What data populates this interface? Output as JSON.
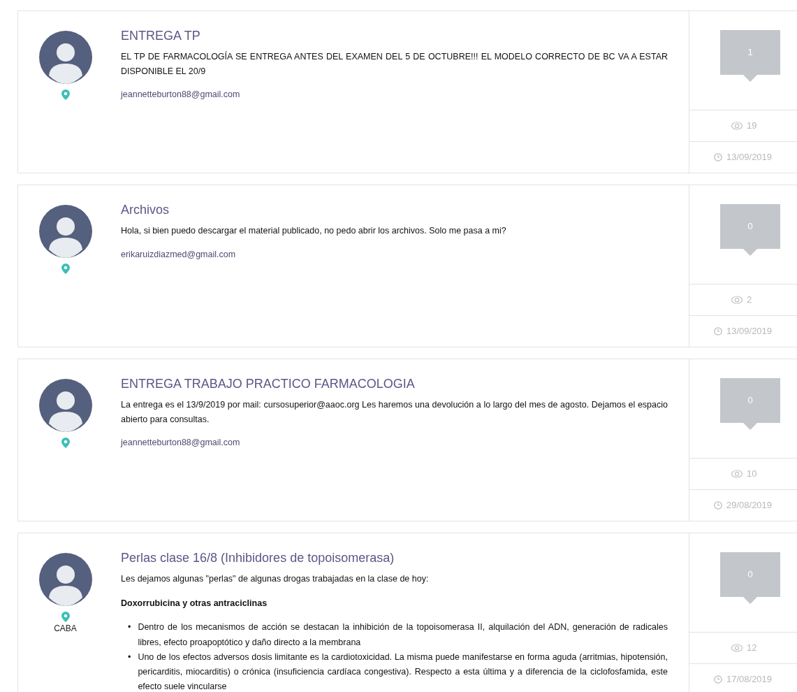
{
  "posts": [
    {
      "title": "ENTREGA TP",
      "body": [
        {
          "kind": "paragraph",
          "text": "EL TP DE FARMACOLOGÍA SE ENTREGA ANTES DEL EXAMEN DEL 5 DE OCTUBRE!!! EL MODELO CORRECTO DE BC VA A ESTAR DISPONIBLE EL 20/9"
        }
      ],
      "email": "jeannetteburton88@gmail.com",
      "comments": "1",
      "views": "19",
      "date": "13/09/2019"
    },
    {
      "title": "Archivos",
      "body": [
        {
          "kind": "paragraph",
          "text": "Hola, si bien puedo descargar el material publicado, no pedo abrir los archivos. Solo me pasa a mi?"
        }
      ],
      "email": "erikaruizdiazmed@gmail.com",
      "comments": "0",
      "views": "2",
      "date": "13/09/2019"
    },
    {
      "title": "ENTREGA TRABAJO PRACTICO FARMACOLOGIA",
      "body": [
        {
          "kind": "paragraph",
          "text": "La entrega es el 13/9/2019 por mail: cursosuperior@aaoc.org Les haremos una devolución a lo largo del mes de agosto. Dejamos el espacio abierto para consultas."
        }
      ],
      "email": "jeannetteburton88@gmail.com",
      "comments": "0",
      "views": "10",
      "date": "29/08/2019"
    },
    {
      "title": "Perlas clase 16/8 (Inhibidores de topoisomerasa)",
      "location": "CABA",
      "body": [
        {
          "kind": "paragraph",
          "text": "Les dejamos algunas \"perlas\" de algunas drogas trabajadas en la clase de hoy:"
        },
        {
          "kind": "heading",
          "text": "Doxorrubicina y otras antraciclinas"
        },
        {
          "kind": "list",
          "marker": "•",
          "items": [
            "Dentro de los mecanismos de acción se destacan la inhibición de la topoisomerasa II, alquilación del ADN, generación de radicales libres, efecto proapoptótico y daño directo a la membrana",
            "Uno de los efectos adversos dosis limitante es la cardiotoxicidad. La misma puede manifestarse en forma aguda (arritmias, hipotensión, pericarditis, miocarditis) o crónica (insuficiencia cardíaca congestiva). Respecto a esta última y a diferencia de la ciclofosfamida, este efecto suele vincularse"
          ]
        }
      ],
      "comments": "0",
      "views": "12",
      "date": "17/08/2019"
    }
  ]
}
